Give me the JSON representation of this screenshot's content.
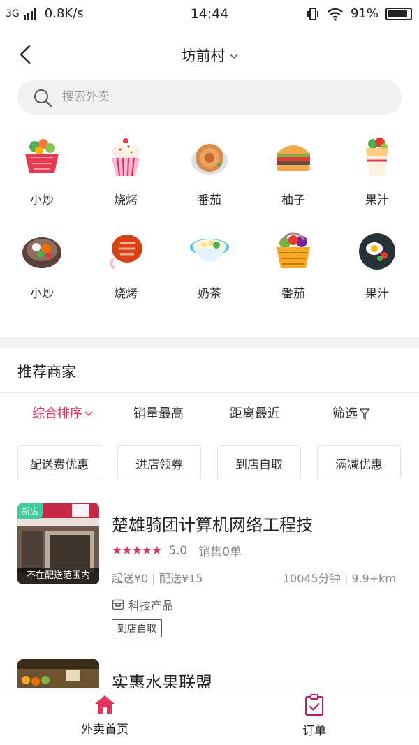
{
  "status_bar": {
    "network": "3G",
    "speed": "0.8K/s",
    "time": "14:44",
    "battery": "91%",
    "battery_level": 0.91
  },
  "header": {
    "location": "坊前村",
    "back_icon": "chevron-left-icon",
    "dropdown_icon": "chevron-down-icon"
  },
  "search": {
    "placeholder": "搜索外卖",
    "icon": "search-icon"
  },
  "categories": [
    {
      "label": "小炒",
      "icon": "veg-basket-icon"
    },
    {
      "label": "烧烤",
      "icon": "cupcake-icon"
    },
    {
      "label": "番茄",
      "icon": "cookie-icon"
    },
    {
      "label": "柚子",
      "icon": "burger-icon"
    },
    {
      "label": "果汁",
      "icon": "wrap-icon"
    },
    {
      "label": "小炒",
      "icon": "hotpot-icon"
    },
    {
      "label": "烧烤",
      "icon": "sausage-icon"
    },
    {
      "label": "奶茶",
      "icon": "noodle-bowl-icon"
    },
    {
      "label": "番茄",
      "icon": "fruit-basket-icon"
    },
    {
      "label": "果汁",
      "icon": "fried-egg-pan-icon"
    }
  ],
  "section_title": "推荐商家",
  "sort": {
    "items": [
      "综合排序",
      "销量最高",
      "距离最近",
      "筛选"
    ],
    "active_color": "#e0335d"
  },
  "filters": [
    "配送费优惠",
    "进店领券",
    "到店自取",
    "满减优惠"
  ],
  "shops": [
    {
      "name": "楚雄骑团计算机网络工程技",
      "new_tag": "新店",
      "range_tag": "不在配送范围内",
      "stars": "★★★★★",
      "score": "5.0",
      "sales": "销售0单",
      "delivery": "起送¥0 | 配送¥15",
      "distance": "10045分钟 | 9.9+km",
      "category": "科技产品",
      "tag": "到店自取"
    },
    {
      "name": "实惠水果联盟"
    }
  ],
  "bottom_nav": [
    {
      "label": "外卖首页",
      "icon": "home-icon",
      "color": "#e0335d"
    },
    {
      "label": "订单",
      "icon": "clipboard-check-icon",
      "color": "#c2185b"
    }
  ]
}
